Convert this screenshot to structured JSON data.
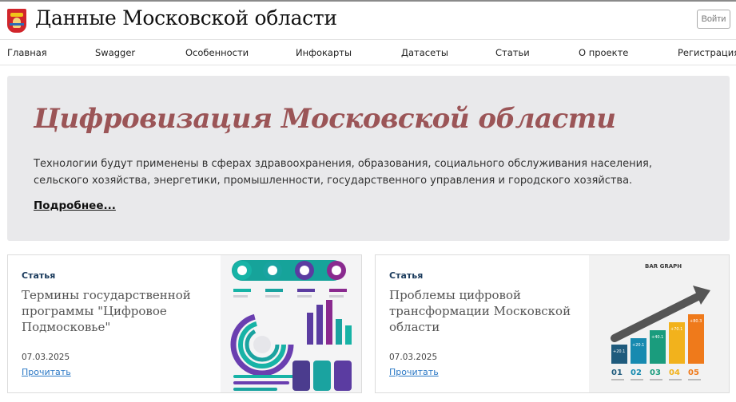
{
  "header": {
    "site_title": "Данные Московской области",
    "login_label": "Войти",
    "logo_icon": "moscow-oblast-coat-of-arms"
  },
  "nav": {
    "items": [
      {
        "label": "Главная"
      },
      {
        "label": "Swagger"
      },
      {
        "label": "Особенности"
      },
      {
        "label": "Инфокарты"
      },
      {
        "label": "Датасеты"
      },
      {
        "label": "Статьи"
      },
      {
        "label": "О проекте"
      },
      {
        "label": "Регистрация"
      }
    ]
  },
  "hero": {
    "title": "Цифровизация Московской области",
    "text": "Технологии будут применены в сферах здравоохранения, образования, социального обслуживания населения, сельского хозяйства, энергетики, промышленности, государственного управления и городского хозяйства.",
    "more_label": "Подробнее..."
  },
  "cards": [
    {
      "tag": "Статья",
      "title": "Термины государственной программы \"Цифровое Подмосковье\"",
      "date": "07.03.2025",
      "read_label": "Прочитать",
      "image": "infographic-circles-bars"
    },
    {
      "tag": "Статья",
      "title": "Проблемы цифровой трансформации Московской области",
      "date": "07.03.2025",
      "read_label": "Прочитать",
      "image": "bar-graph-growth-arrow",
      "image_text": {
        "heading": "BAR GRAPH",
        "values": [
          "+20.1",
          "+20.1",
          "+40.1",
          "+70.1",
          "+80.3"
        ],
        "steps": [
          "01",
          "02",
          "03",
          "04",
          "05"
        ]
      }
    }
  ],
  "colors": {
    "accent_title": "#9b5557",
    "link": "#2b78c5",
    "tag": "#1a3a5c",
    "hero_bg": "#e9e9eb"
  }
}
